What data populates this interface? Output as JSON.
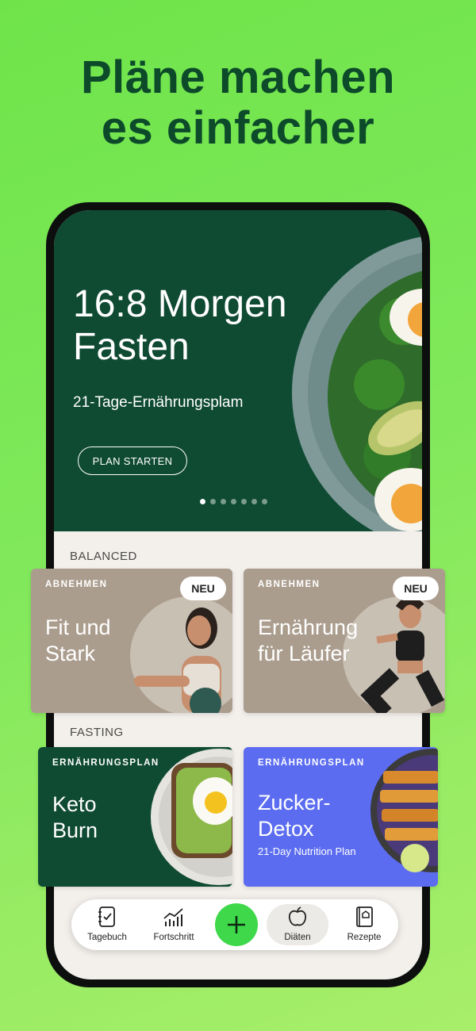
{
  "headline": {
    "line1": "Pläne machen",
    "line2": "es einfacher"
  },
  "hero": {
    "title_line1": "16:8 Morgen",
    "title_line2": "Fasten",
    "subtitle": "21-Tage-Ernährungsplam",
    "button": "PLAN STARTEN",
    "carousel": {
      "pages": 7,
      "active_index": 0
    }
  },
  "sections": {
    "balanced": "BALANCED",
    "fasting": "FASTING"
  },
  "cards": {
    "fit": {
      "category": "ABNEHMEN",
      "title_line1": "Fit und",
      "title_line2": "Stark",
      "badge": "NEU"
    },
    "runner": {
      "category": "ABNEHMEN",
      "title_line1": "Ernährung",
      "title_line2": "für Läufer",
      "badge": "NEU"
    },
    "keto": {
      "category": "ERNÄHRUNGSPLAN",
      "title_line1": "Keto",
      "title_line2": "Burn"
    },
    "detox": {
      "category": "ERNÄHRUNGSPLAN",
      "title_line1": "Zucker-",
      "title_line2": "Detox",
      "subtitle": "21-Day Nutrition Plan"
    }
  },
  "tabbar": {
    "tagebuch": "Tagebuch",
    "fortschritt": "Fortschritt",
    "add_icon": "plus-icon",
    "diaeten": "Diäten",
    "rezepte": "Rezepte",
    "selected": "Diäten"
  },
  "colors": {
    "background_green": "#7fe85a",
    "headline": "#0c4a2a",
    "hero_green": "#0f4a33",
    "taupe_card": "#ab9d8e",
    "keto_card": "#0f4a33",
    "detox_card": "#5b6cf0",
    "add_button": "#3ed84a"
  }
}
